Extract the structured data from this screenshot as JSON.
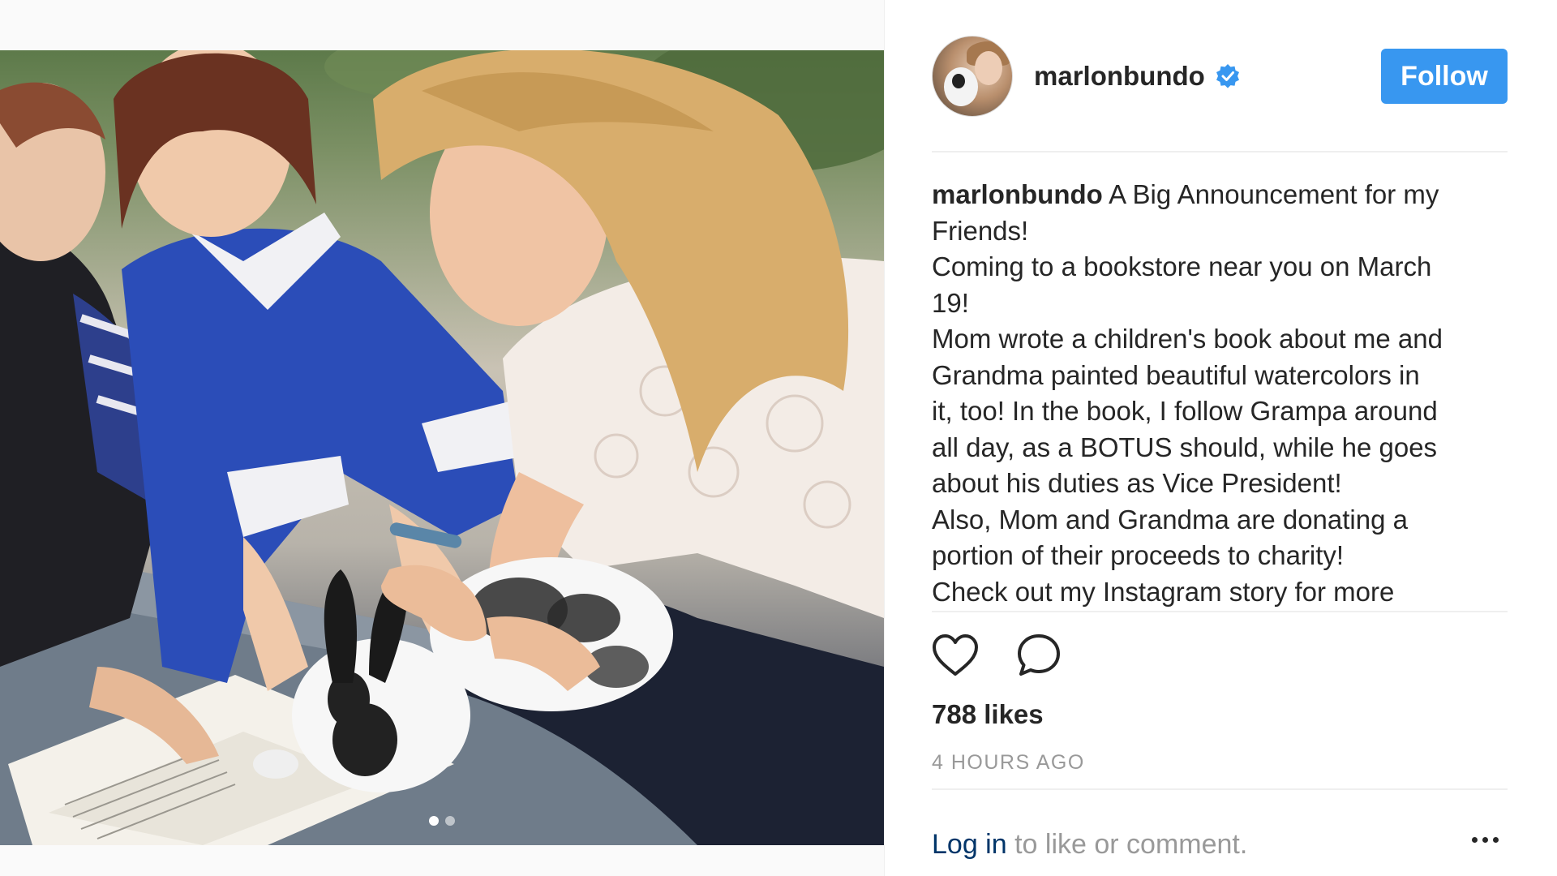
{
  "post": {
    "username": "marlonbundo",
    "follow_label": "Follow",
    "caption_user": "marlonbundo",
    "caption_lines": [
      "A Big Announcement for my",
      "Friends!",
      "Coming to a bookstore near you on March",
      "19!",
      "Mom wrote a children's book about me and",
      "Grandma painted beautiful watercolors in",
      "it, too! In the book, I follow Grampa around",
      "all day, as a BOTUS should, while he goes",
      "about his duties as Vice President!",
      "Also, Mom and Grandma are donating a",
      "portion of their proceeds to charity!",
      "Check out my Instagram story for more"
    ],
    "likes": "788 likes",
    "time": "4 HOURS AGO",
    "login_link": "Log in",
    "login_rest": " to like or comment."
  },
  "icons": {
    "verified": "verified-badge-icon",
    "like": "heart-icon",
    "comment": "comment-bubble-icon",
    "more": "more-options-icon"
  },
  "colors": {
    "accent": "#3897f0",
    "link": "#003569",
    "muted": "#999999",
    "text": "#262626"
  },
  "carousel": {
    "count": 2,
    "active_index": 0
  }
}
